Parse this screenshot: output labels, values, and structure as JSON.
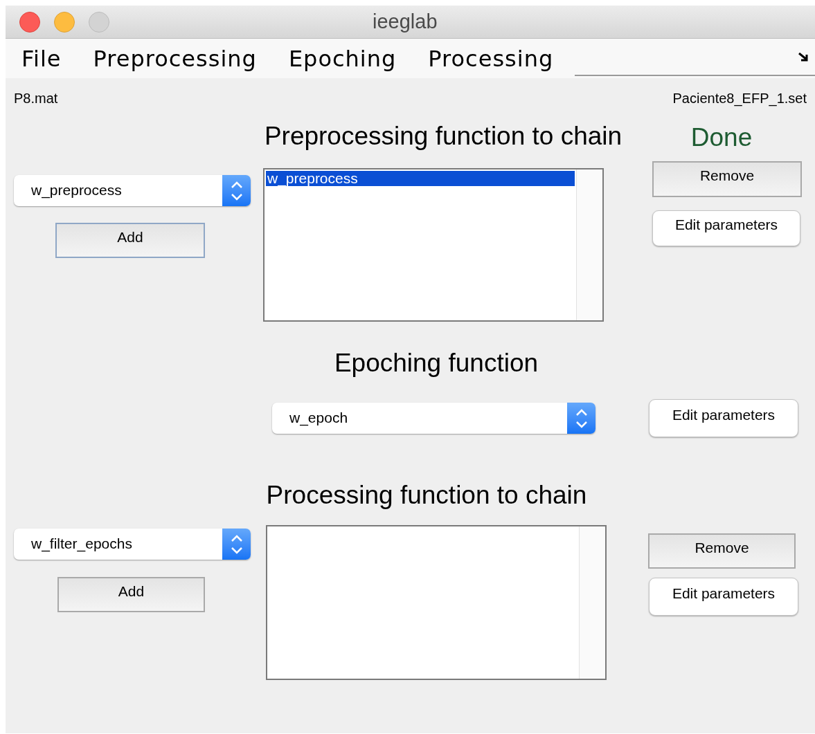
{
  "window": {
    "title": "ieeglab"
  },
  "menu": [
    {
      "label": "File"
    },
    {
      "label": "Preprocessing"
    },
    {
      "label": "Epoching"
    },
    {
      "label": "Processing"
    }
  ],
  "file_left": "P8.mat",
  "file_right": "Paciente8_EFP_1.set",
  "status": "Done",
  "preprocessing": {
    "heading": "Preprocessing function to chain",
    "dropdown": "w_preprocess",
    "add": "Add",
    "list": [
      {
        "label": "w_preprocess",
        "selected": true
      }
    ],
    "remove": "Remove",
    "edit": "Edit parameters"
  },
  "epoching": {
    "heading": "Epoching function",
    "dropdown": "w_epoch",
    "edit": "Edit parameters"
  },
  "processing": {
    "heading": "Processing function to chain",
    "dropdown": "w_filter_epochs",
    "add": "Add",
    "remove": "Remove",
    "edit": "Edit parameters"
  }
}
